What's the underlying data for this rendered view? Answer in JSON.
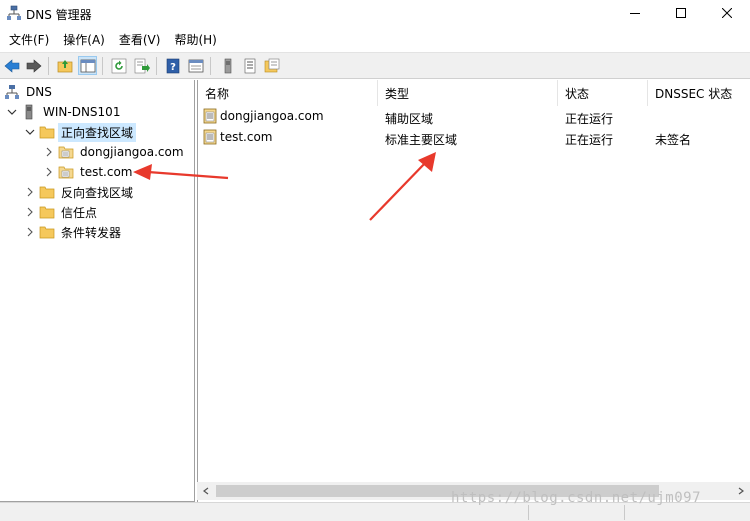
{
  "window": {
    "title": "DNS 管理器",
    "icon": "dns-manager-icon"
  },
  "menu": {
    "items": [
      "文件(F)",
      "操作(A)",
      "查看(V)",
      "帮助(H)"
    ]
  },
  "toolbar": {
    "icons": [
      "back-arrow-icon",
      "forward-arrow-icon",
      "up-folder-icon",
      "show-tree-icon",
      "refresh-icon",
      "export-icon",
      "help-icon",
      "console-view-icon",
      "server-icon",
      "list-icon",
      "properties-icon"
    ]
  },
  "tree": {
    "items": [
      {
        "label": "DNS",
        "icon": "dns-icon"
      },
      {
        "label": "WIN-DNS101",
        "icon": "server-icon"
      },
      {
        "label": "正向查找区域",
        "icon": "folder-icon",
        "selected": true
      },
      {
        "label": "dongjiangoa.com",
        "icon": "zone-icon"
      },
      {
        "label": "test.com",
        "icon": "zone-icon"
      },
      {
        "label": "反向查找区域",
        "icon": "folder-icon"
      },
      {
        "label": "信任点",
        "icon": "folder-icon"
      },
      {
        "label": "条件转发器",
        "icon": "folder-icon"
      }
    ]
  },
  "list": {
    "columns": [
      "名称",
      "类型",
      "状态",
      "DNSSEC 状态"
    ],
    "rows": [
      {
        "name": "dongjiangoa.com",
        "type": "辅助区域",
        "status": "正在运行",
        "dnssec": ""
      },
      {
        "name": "test.com",
        "type": "标准主要区域",
        "status": "正在运行",
        "dnssec": "未签名"
      }
    ]
  },
  "watermark": "https://blog.csdn.net/ujm097",
  "colors": {
    "accent_red": "#e8392c",
    "selection": "#cce8ff",
    "folder": "#f5c85c"
  }
}
